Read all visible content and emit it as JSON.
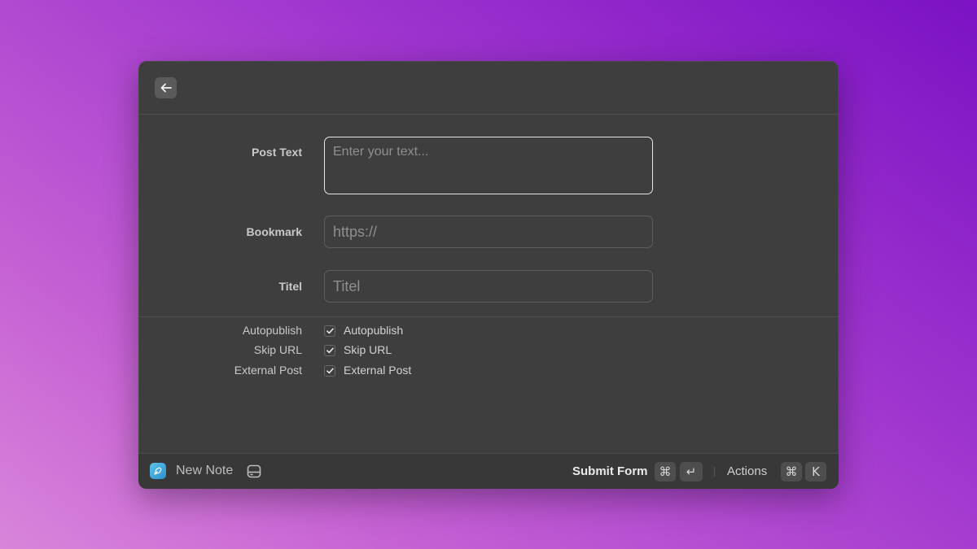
{
  "form": {
    "post_text": {
      "label": "Post Text",
      "placeholder": "Enter your text...",
      "value": ""
    },
    "bookmark": {
      "label": "Bookmark",
      "placeholder": "https://",
      "value": ""
    },
    "titel": {
      "label": "Titel",
      "placeholder": "Titel",
      "value": ""
    },
    "checkboxes": [
      {
        "label": "Autopublish",
        "text": "Autopublish",
        "checked": true
      },
      {
        "label": "Skip URL",
        "text": "Skip URL",
        "checked": true
      },
      {
        "label": "External Post",
        "text": "External Post",
        "checked": true
      }
    ]
  },
  "footer": {
    "app_name": "New Note",
    "submit_label": "Submit Form",
    "submit_keys": [
      "⌘",
      "↵"
    ],
    "actions_label": "Actions",
    "actions_keys": [
      "⌘",
      "K"
    ]
  },
  "icons": {
    "back": "arrow-left-icon",
    "app": "pen-nib-icon",
    "storage": "hard-drive-icon",
    "check": "checkmark-icon"
  }
}
